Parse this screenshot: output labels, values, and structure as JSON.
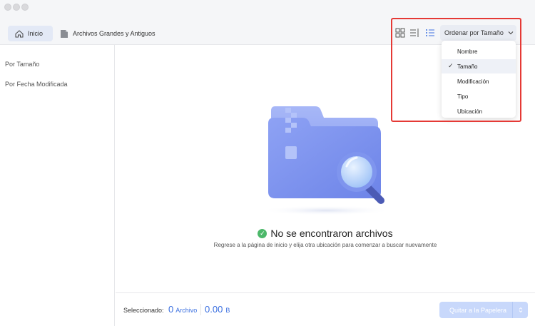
{
  "nav": {
    "home_label": "Inicio",
    "large_old_label": "Archivos Grandes y Antiguos"
  },
  "toolbar": {
    "sort_label": "Ordenar por Tamaño",
    "view_icons": [
      "grid-view-icon",
      "column-view-icon",
      "list-view-icon"
    ]
  },
  "sidebar": {
    "items": [
      {
        "label": "Por Tamaño"
      },
      {
        "label": "Por Fecha Modificada"
      }
    ]
  },
  "sort_menu": {
    "items": [
      {
        "label": "Nombre",
        "selected": false
      },
      {
        "label": "Tamaño",
        "selected": true
      },
      {
        "label": "Modificación",
        "selected": false
      },
      {
        "label": "Tipo",
        "selected": false
      },
      {
        "label": "Ubicación",
        "selected": false
      }
    ],
    "check_glyph": "✓"
  },
  "empty_state": {
    "title": "No se encontraron archivos",
    "subtitle": "Regrese a la página de inicio y elija otra ubicación para comenzar a buscar nuevamente"
  },
  "footer": {
    "selected_label": "Seleccionado:",
    "count_value": "0",
    "count_unit": "Archivo",
    "size_value": "0.00",
    "size_unit": "B",
    "trash_button": "Quitar a la Papelera"
  },
  "colors": {
    "accent": "#3a6fe0",
    "highlight": "#e53935",
    "success": "#4cb86a"
  }
}
